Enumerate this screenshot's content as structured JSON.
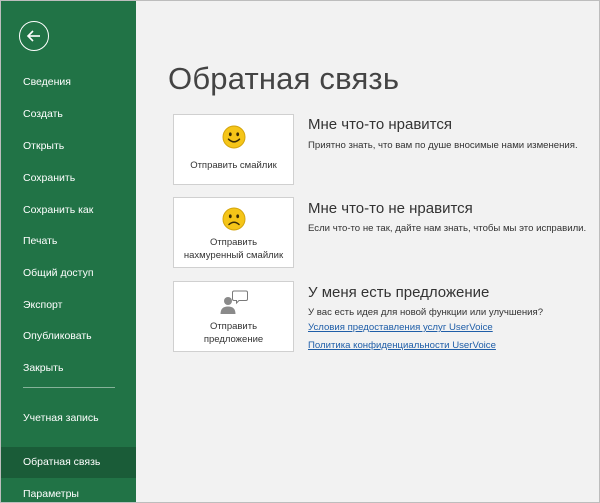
{
  "sidebar": {
    "back_icon": "arrow-left-icon",
    "items": [
      {
        "id": "info",
        "label": "Сведения"
      },
      {
        "id": "new",
        "label": "Создать"
      },
      {
        "id": "open",
        "label": "Открыть"
      },
      {
        "id": "save",
        "label": "Сохранить"
      },
      {
        "id": "save-as",
        "label": "Сохранить как"
      },
      {
        "id": "print",
        "label": "Печать"
      },
      {
        "id": "share",
        "label": "Общий доступ"
      },
      {
        "id": "export",
        "label": "Экспорт"
      },
      {
        "id": "publish",
        "label": "Опубликовать"
      },
      {
        "id": "close",
        "label": "Закрыть"
      },
      {
        "id": "account",
        "label": "Учетная запись"
      },
      {
        "id": "feedback",
        "label": "Обратная связь",
        "selected": true
      },
      {
        "id": "options",
        "label": "Параметры"
      }
    ]
  },
  "main": {
    "title": "Обратная связь",
    "sections": [
      {
        "card_label": "Отправить смайлик",
        "icon": "smiley-face-icon",
        "title": "Мне что-то нравится",
        "description": "Приятно знать, что вам по душе вносимые нами изменения."
      },
      {
        "card_label_line1": "Отправить",
        "card_label_line2": "нахмуренный смайлик",
        "icon": "frown-face-icon",
        "title": "Мне что-то не нравится",
        "description": "Если что-то не так, дайте нам знать, чтобы мы это исправили."
      },
      {
        "card_label_line1": "Отправить",
        "card_label_line2": "предложение",
        "icon": "person-speech-bubble-icon",
        "title": "У меня есть предложение",
        "description": "У вас есть идея для новой функции или улучшения?",
        "links": [
          "Условия предоставления услуг UserVoice",
          "Политика конфиденциальности UserVoice"
        ]
      }
    ]
  },
  "colors": {
    "sidebar_bg": "#217346",
    "sidebar_selected": "#1a5c38",
    "main_bg": "#f2f2f2",
    "smiley_yellow": "#f5c518",
    "link": "#1f5ea8"
  }
}
